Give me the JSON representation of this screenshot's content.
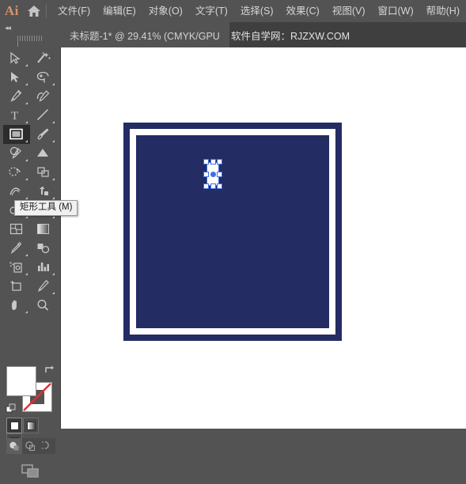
{
  "app": {
    "name": "Ai",
    "logo_color": "#d9936a",
    "home_icon": "home-icon"
  },
  "menubar": {
    "items": [
      {
        "label": "文件(F)",
        "name": "menu-file"
      },
      {
        "label": "编辑(E)",
        "name": "menu-edit"
      },
      {
        "label": "对象(O)",
        "name": "menu-object"
      },
      {
        "label": "文字(T)",
        "name": "menu-type"
      },
      {
        "label": "选择(S)",
        "name": "menu-select"
      },
      {
        "label": "效果(C)",
        "name": "menu-effect"
      },
      {
        "label": "视图(V)",
        "name": "menu-view"
      },
      {
        "label": "窗口(W)",
        "name": "menu-window"
      },
      {
        "label": "帮助(H)",
        "name": "menu-help"
      }
    ]
  },
  "tabbar": {
    "collapse_icon": "double-chevron-left-icon",
    "document_tab": "未标题-1* @ 29.41% (CMYK/GPU",
    "watermark": "软件自学网：RJZXW.COM"
  },
  "toolbar": {
    "tooltip": "矩形工具 (M)",
    "active_tool": "rectangle-tool",
    "tools": [
      {
        "name": "selection-tool",
        "has_flyout": true
      },
      {
        "name": "magic-wand-tool",
        "has_flyout": false
      },
      {
        "name": "direct-selection-tool",
        "has_flyout": true
      },
      {
        "name": "lasso-tool",
        "has_flyout": true
      },
      {
        "name": "pen-tool",
        "has_flyout": true
      },
      {
        "name": "curvature-tool",
        "has_flyout": false
      },
      {
        "name": "type-tool",
        "has_flyout": true
      },
      {
        "name": "line-segment-tool",
        "has_flyout": true
      },
      {
        "name": "rectangle-tool",
        "has_flyout": true
      },
      {
        "name": "paintbrush-tool",
        "has_flyout": true
      },
      {
        "name": "shaper-tool",
        "has_flyout": true
      },
      {
        "name": "gradient-mesh-tool",
        "has_flyout": false
      },
      {
        "name": "eraser-tool",
        "has_flyout": true
      },
      {
        "name": "scale-tool",
        "has_flyout": true
      },
      {
        "name": "width-tool",
        "has_flyout": true
      },
      {
        "name": "free-transform-tool",
        "has_flyout": true
      },
      {
        "name": "shape-builder-tool",
        "has_flyout": true
      },
      {
        "name": "perspective-grid-tool",
        "has_flyout": true
      },
      {
        "name": "mesh-tool",
        "has_flyout": false
      },
      {
        "name": "gradient-tool",
        "has_flyout": false
      },
      {
        "name": "eyedropper-tool",
        "has_flyout": true
      },
      {
        "name": "blend-tool",
        "has_flyout": false
      },
      {
        "name": "symbol-sprayer-tool",
        "has_flyout": true
      },
      {
        "name": "column-graph-tool",
        "has_flyout": true
      },
      {
        "name": "artboard-tool",
        "has_flyout": false
      },
      {
        "name": "slice-tool",
        "has_flyout": true
      },
      {
        "name": "hand-tool",
        "has_flyout": true
      },
      {
        "name": "zoom-tool",
        "has_flyout": false
      }
    ],
    "color": {
      "fill_swatch": "#ffffff",
      "stroke_swatch": "none",
      "swap_icon": "swap-fill-stroke-icon",
      "default_icon": "default-fill-stroke-icon",
      "modes": [
        {
          "name": "color-mode-button",
          "selected": true
        },
        {
          "name": "gradient-mode-button",
          "selected": false
        },
        {
          "name": "none-mode-button",
          "selected": false
        }
      ],
      "draw_modes": [
        {
          "name": "draw-normal-button",
          "selected": true
        },
        {
          "name": "draw-behind-button",
          "selected": false
        },
        {
          "name": "draw-inside-button",
          "selected": false
        }
      ],
      "screen_mode": "change-screen-mode-button"
    }
  },
  "canvas": {
    "background": "#ffffff",
    "artwork": {
      "name": "nested-square-artwork",
      "outer_color": "#232c63",
      "ring_color": "#ffffff",
      "inner_color": "#232c63"
    },
    "selection": {
      "name": "selected-rectangle",
      "fill": "#ffffff",
      "handle_color": "#3f6fe0",
      "handles": 8
    }
  }
}
